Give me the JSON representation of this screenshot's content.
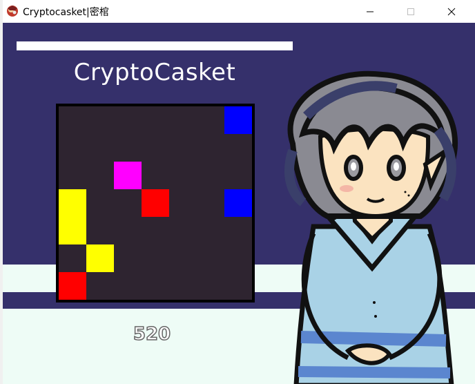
{
  "window": {
    "title": "Cryptocasket|密棺"
  },
  "game": {
    "title": "CryptoCasket",
    "progress_fraction": 1.0,
    "score": "520",
    "grid": {
      "rows": 7,
      "cols": 7,
      "colors": {
        "blue": "#0000ff",
        "magenta": "#ff00ff",
        "red": "#ff0000",
        "yellow": "#ffff00"
      },
      "cells": [
        {
          "row": 0,
          "col": 6,
          "color": "blue"
        },
        {
          "row": 2,
          "col": 2,
          "color": "magenta"
        },
        {
          "row": 3,
          "col": 3,
          "color": "red"
        },
        {
          "row": 3,
          "col": 6,
          "color": "blue"
        },
        {
          "row": 3,
          "col": 0,
          "color": "yellow"
        },
        {
          "row": 4,
          "col": 0,
          "color": "yellow"
        },
        {
          "row": 5,
          "col": 1,
          "color": "yellow"
        },
        {
          "row": 6,
          "col": 0,
          "color": "red"
        }
      ]
    }
  }
}
